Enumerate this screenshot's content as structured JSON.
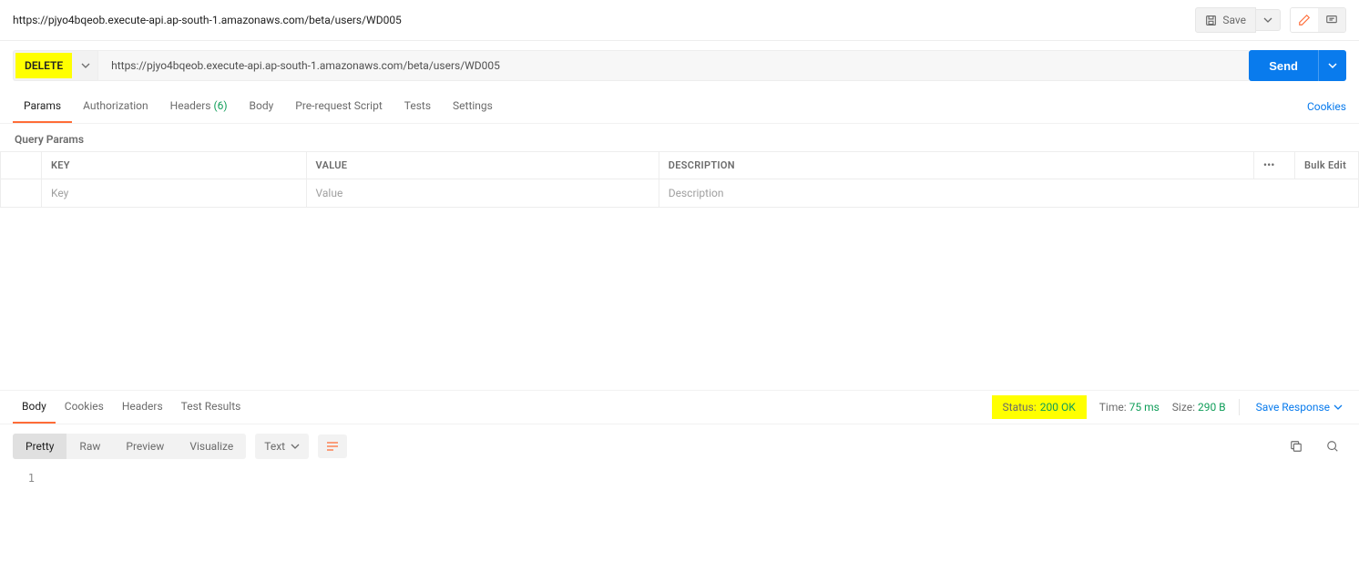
{
  "tab_title": "https://pjyo4bqeob.execute-api.ap-south-1.amazonaws.com/beta/users/WD005",
  "save_label": "Save",
  "request": {
    "method": "DELETE",
    "url": "https://pjyo4bqeob.execute-api.ap-south-1.amazonaws.com/beta/users/WD005",
    "send_label": "Send"
  },
  "request_tabs": {
    "params": "Params",
    "auth": "Authorization",
    "headers": "Headers",
    "headers_count": "(6)",
    "body": "Body",
    "prerequest": "Pre-request Script",
    "tests": "Tests",
    "settings": "Settings",
    "cookies": "Cookies"
  },
  "params_section": {
    "title": "Query Params",
    "key_header": "KEY",
    "value_header": "VALUE",
    "desc_header": "DESCRIPTION",
    "bulk_edit": "Bulk Edit",
    "key_placeholder": "Key",
    "value_placeholder": "Value",
    "desc_placeholder": "Description"
  },
  "response_tabs": {
    "body": "Body",
    "cookies": "Cookies",
    "headers": "Headers",
    "test_results": "Test Results"
  },
  "response_status": {
    "status_label": "Status:",
    "status_value": "200 OK",
    "time_label": "Time:",
    "time_value": "75 ms",
    "size_label": "Size:",
    "size_value": "290 B",
    "save_response": "Save Response"
  },
  "response_views": {
    "pretty": "Pretty",
    "raw": "Raw",
    "preview": "Preview",
    "visualize": "Visualize",
    "format": "Text"
  },
  "code": {
    "line_number": "1",
    "content": ""
  }
}
